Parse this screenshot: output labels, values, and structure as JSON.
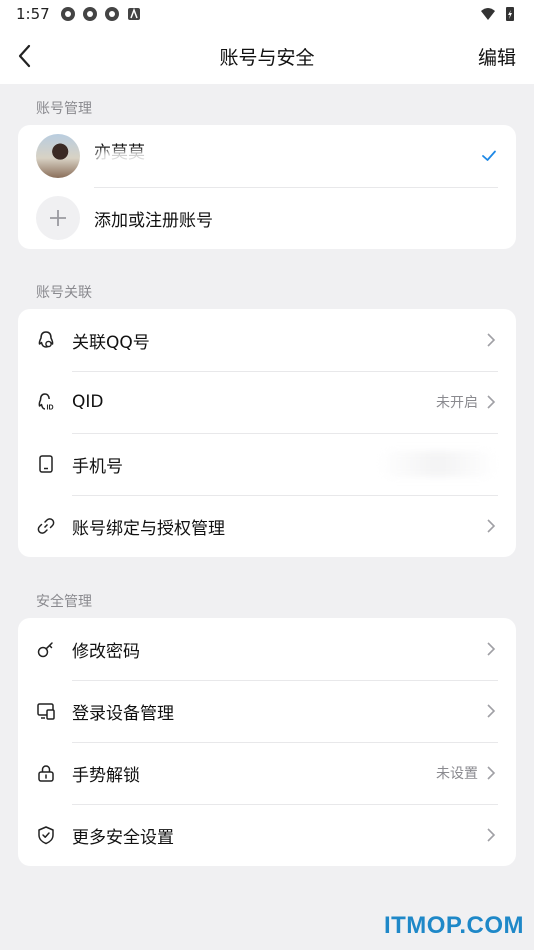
{
  "status_bar": {
    "time": "1:57"
  },
  "nav": {
    "title": "账号与安全",
    "edit_label": "编辑"
  },
  "accounts_section": {
    "header": "账号管理",
    "current_account": {
      "name": "亦莫莫"
    },
    "add_label": "添加或注册账号"
  },
  "link_section": {
    "header": "账号关联",
    "items": [
      {
        "label": "关联QQ号",
        "status": "",
        "icon": "qq-penguin-icon"
      },
      {
        "label": "QID",
        "status": "未开启",
        "icon": "qid-icon"
      },
      {
        "label": "手机号",
        "status": "",
        "icon": "phone-icon"
      },
      {
        "label": "账号绑定与授权管理",
        "status": "",
        "icon": "link-icon"
      }
    ]
  },
  "security_section": {
    "header": "安全管理",
    "items": [
      {
        "label": "修改密码",
        "status": "",
        "icon": "key-icon"
      },
      {
        "label": "登录设备管理",
        "status": "",
        "icon": "devices-icon"
      },
      {
        "label": "手势解锁",
        "status": "未设置",
        "icon": "lock-icon"
      },
      {
        "label": "更多安全设置",
        "status": "",
        "icon": "shield-icon"
      }
    ]
  },
  "watermark": "ITMOP.COM",
  "colors": {
    "accent": "#1e88e5",
    "background": "#f0f0f2",
    "secondary_text": "#8a8a8f"
  }
}
